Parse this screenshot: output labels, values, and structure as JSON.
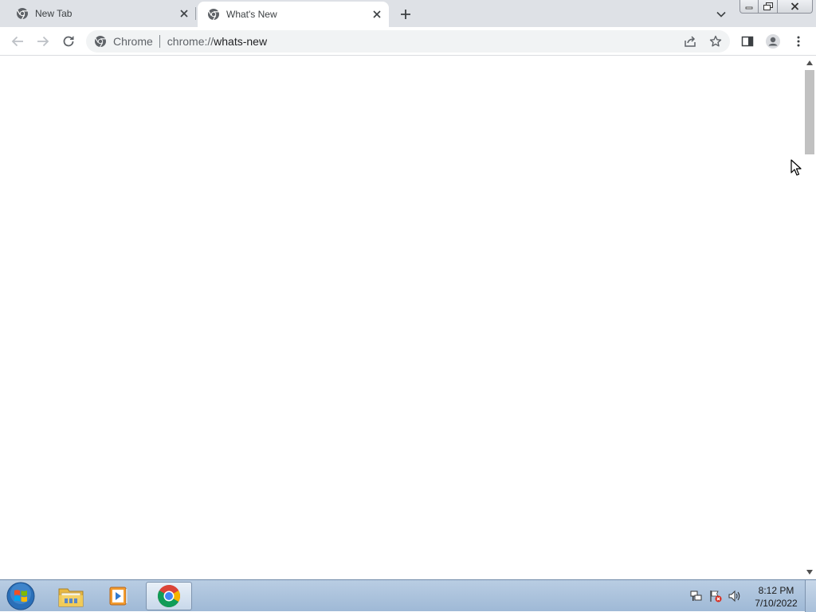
{
  "tabs": [
    {
      "title": "New Tab",
      "favicon": "chrome-icon",
      "active": false
    },
    {
      "title": "What's New",
      "favicon": "chrome-icon",
      "active": true
    }
  ],
  "toolbar": {
    "omnibox": {
      "chip_label": "Chrome",
      "url_prefix": "chrome://",
      "url_path": "whats-new"
    }
  },
  "taskbar": {
    "apps": [
      "windows-explorer",
      "media-player",
      "chrome"
    ],
    "clock_time": "8:12 PM",
    "clock_date": "7/10/2022"
  },
  "colors": {
    "tabstrip": "#dee1e6",
    "omnibox": "#f1f3f4",
    "taskbar": "#a9c0da",
    "scrollbar_thumb": "#c1c1c1"
  }
}
